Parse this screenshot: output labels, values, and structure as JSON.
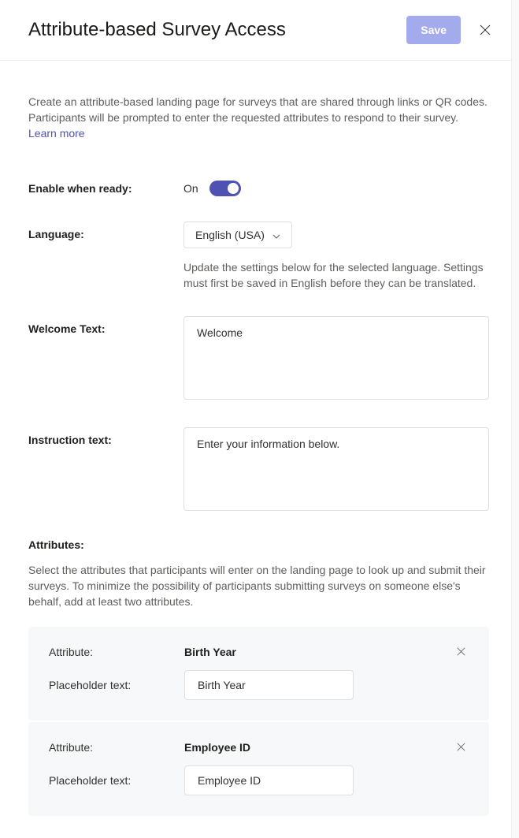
{
  "header": {
    "title": "Attribute-based Survey Access",
    "save_label": "Save"
  },
  "description": {
    "text": "Create an attribute-based landing page for surveys that are shared through links or QR codes. Participants will be prompted to enter the requested attributes to respond to their survey. ",
    "learn_more": "Learn more"
  },
  "form": {
    "enable_label": "Enable when ready:",
    "enable_state": "On",
    "language_label": "Language:",
    "language_value": "English (USA)",
    "language_help": "Update the settings below for the selected language. Settings must first be saved in English before they can be translated.",
    "welcome_label": "Welcome Text:",
    "welcome_value": "Welcome",
    "instruction_label": "Instruction text:",
    "instruction_value": "Enter your information below."
  },
  "attributes": {
    "heading": "Attributes:",
    "help": "Select the attributes that participants will enter on the landing page to look up and submit their surveys. To minimize the possibility of participants submitting surveys on someone else's behalf, add at least two attributes.",
    "attr_label": "Attribute:",
    "placeholder_label": "Placeholder text:",
    "items": [
      {
        "name": "Birth Year",
        "placeholder": "Birth Year"
      },
      {
        "name": "Employee ID",
        "placeholder": "Employee ID"
      }
    ]
  }
}
